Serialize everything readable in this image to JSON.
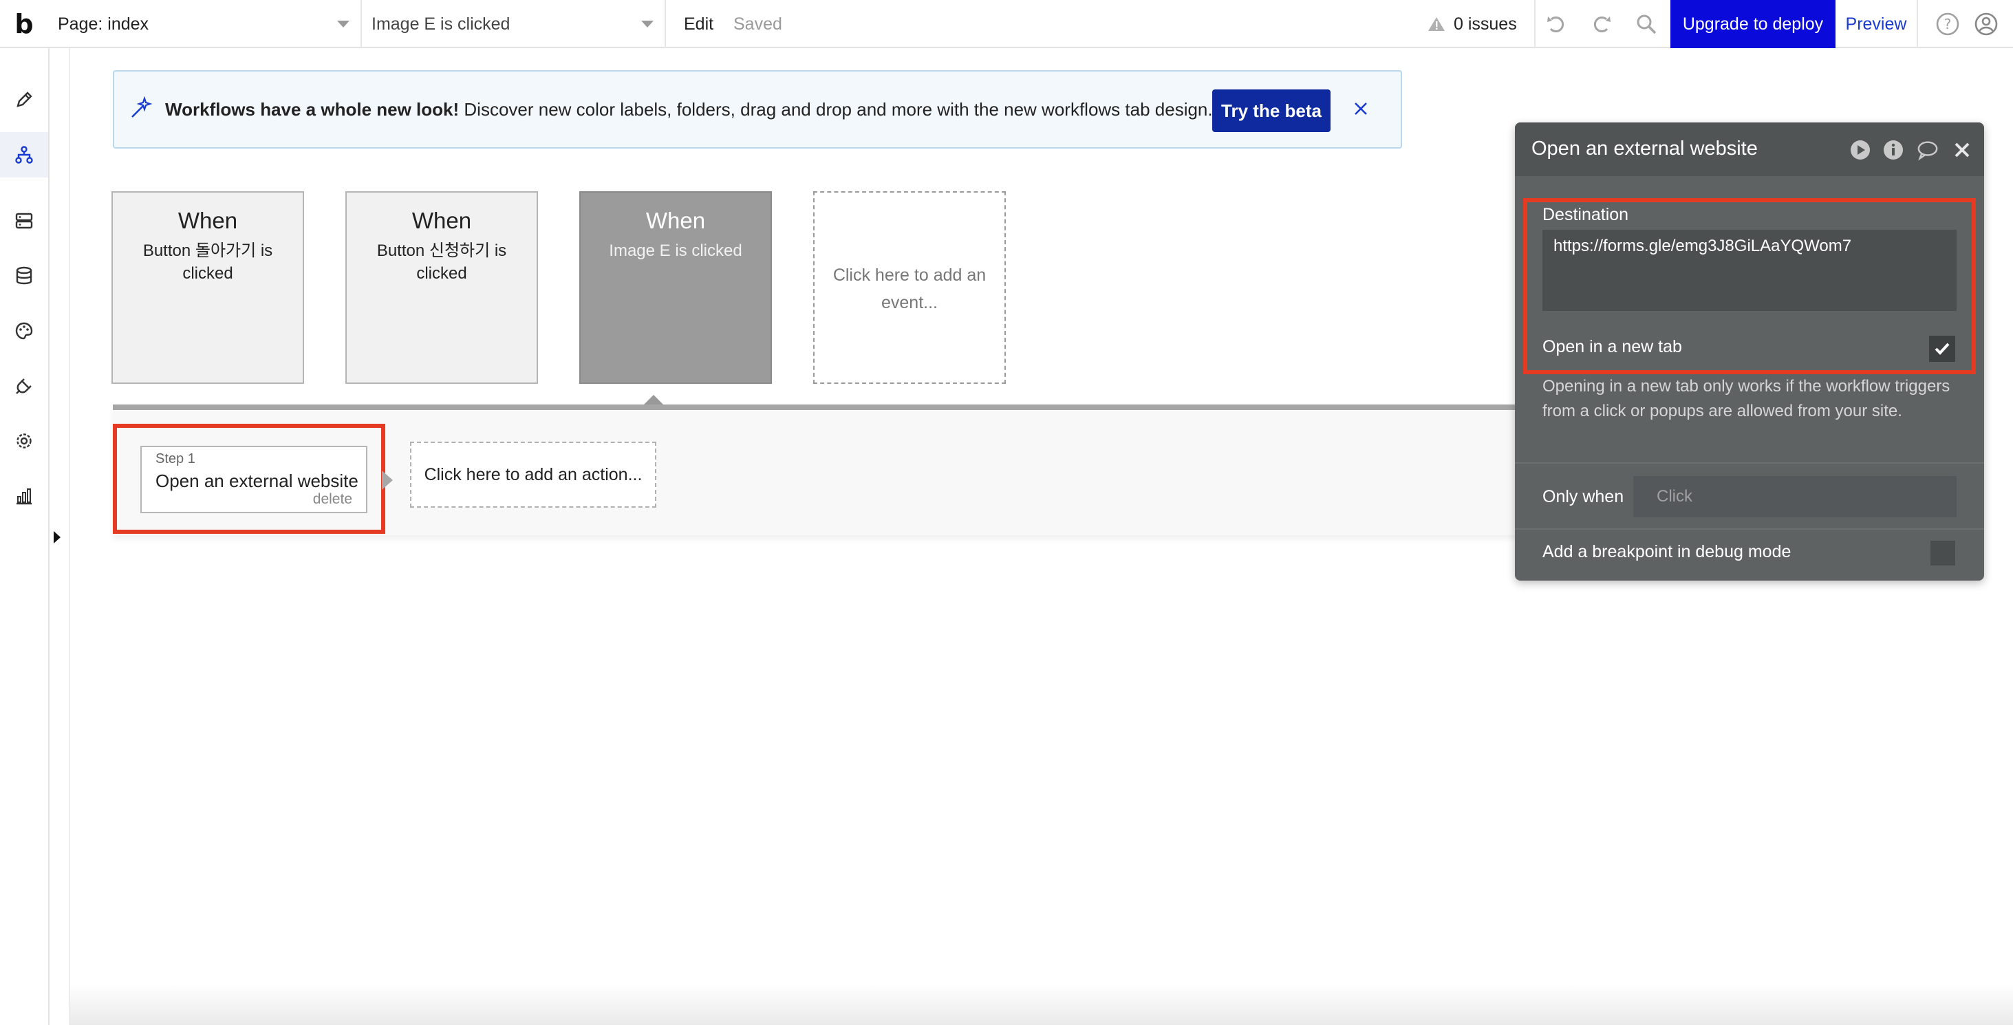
{
  "topbar": {
    "logo": "b",
    "page_selector": "Page: index",
    "workflow_selector": "Image E is clicked",
    "edit_label": "Edit",
    "saved_label": "Saved",
    "issues_label": "0 issues",
    "upgrade_label": "Upgrade to deploy",
    "preview_label": "Preview",
    "colors": {
      "upgrade_bg": "#0a0adb",
      "preview_text": "#1a3bd1"
    }
  },
  "sidebar": {
    "items": [
      {
        "icon": "pencil-icon",
        "active": false
      },
      {
        "icon": "workflow-icon",
        "active": true
      },
      {
        "icon": "data-server-icon",
        "active": false
      },
      {
        "icon": "database-icon",
        "active": false
      },
      {
        "icon": "palette-icon",
        "active": false
      },
      {
        "icon": "plugin-icon",
        "active": false
      },
      {
        "icon": "settings-gear-icon",
        "active": false
      },
      {
        "icon": "logs-chart-icon",
        "active": false
      }
    ]
  },
  "banner": {
    "title_bold": "Workflows have a whole new look!",
    "text": " Discover new color labels, folders, drag and drop and more with the new workflows tab design.",
    "button_label": "Try the beta",
    "colors": {
      "bg": "#f3f8fc",
      "button": "#0e2a9e"
    }
  },
  "events": [
    {
      "when": "When",
      "desc": "Button 돌아가기 is clicked",
      "selected": false
    },
    {
      "when": "When",
      "desc": "Button 신청하기 is clicked",
      "selected": false
    },
    {
      "when": "When",
      "desc": "Image E is clicked",
      "selected": true
    }
  ],
  "add_event_label": "Click here to add an event...",
  "actions": {
    "step_label": "Step 1",
    "step_title": "Open an external website",
    "delete_label": "delete",
    "add_action_label": "Click here to add an action..."
  },
  "panel": {
    "title": "Open an external website",
    "destination_label": "Destination",
    "destination_value": "https://forms.gle/emg3J8GiLAaYQWom7",
    "new_tab_label": "Open in a new tab",
    "new_tab_checked": true,
    "note": "Opening in a new tab only works if the workflow triggers from a click or popups are allowed from your site.",
    "only_when_label": "Only when",
    "only_when_placeholder": "Click",
    "breakpoint_label": "Add a breakpoint in debug mode",
    "colors": {
      "bg": "#5f6263",
      "highlight": "#e53b22"
    }
  }
}
